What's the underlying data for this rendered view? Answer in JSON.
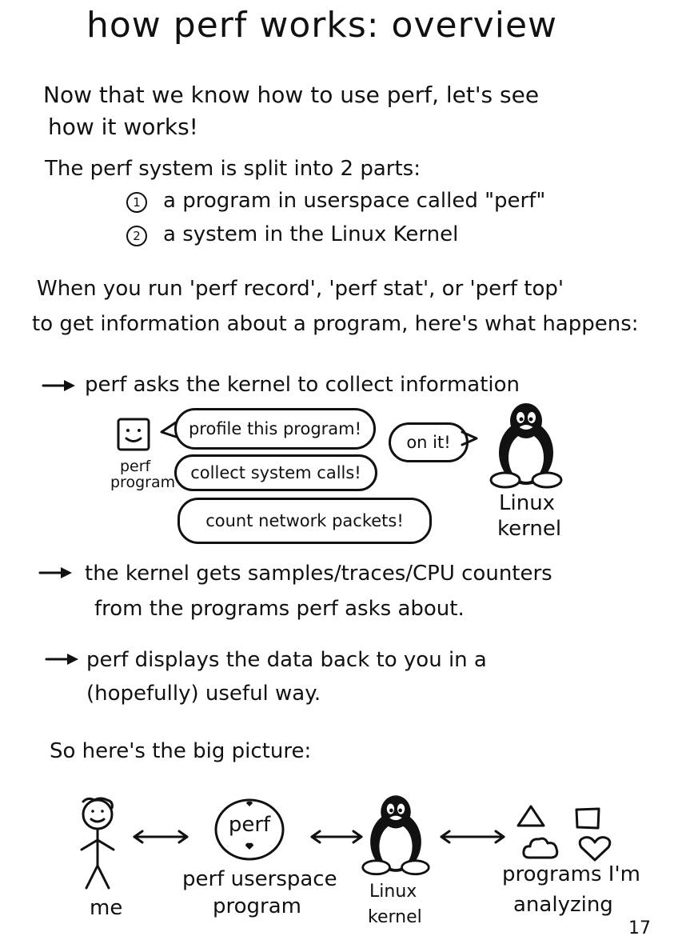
{
  "title": "how perf works: overview",
  "intro": {
    "line1": "Now that we know how to use perf, let's see",
    "line2": "how it works!"
  },
  "parts": {
    "heading": "The perf system is split into 2 parts:",
    "item1_num": "1",
    "item1": "a program in userspace called \"perf\"",
    "item2_num": "2",
    "item2": "a system in the Linux Kernel"
  },
  "when": {
    "line1": "When you run 'perf record', 'perf stat', or 'perf top'",
    "line2": "to get information about a program, here's what happens:"
  },
  "step1": {
    "text": "perf asks the kernel to collect information",
    "perf_label_1": "perf",
    "perf_label_2": "program",
    "bubble1": "profile this program!",
    "bubble2": "collect system calls!",
    "bubble3": "count network packets!",
    "reply": "on it!",
    "kernel_label_1": "Linux",
    "kernel_label_2": "kernel"
  },
  "step2": {
    "line1": "the kernel gets samples/traces/CPU counters",
    "line2": "from the programs perf asks about."
  },
  "step3": {
    "line1": "perf displays the data back to you in a",
    "line2": "(hopefully) useful way."
  },
  "big_picture": {
    "heading": "So here's the big picture:",
    "me": "me",
    "perf_circle": "perf",
    "perf_label_1": "perf userspace",
    "perf_label_2": "program",
    "kernel_label_1": "Linux",
    "kernel_label_2": "kernel",
    "programs_label_1": "programs I'm",
    "programs_label_2": "analyzing"
  },
  "page_number": "17"
}
